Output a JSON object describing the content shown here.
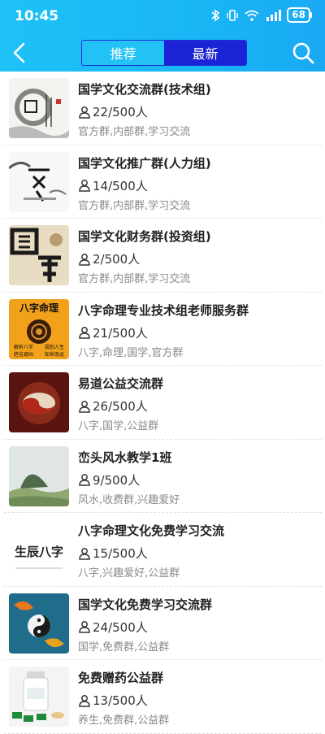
{
  "status": {
    "time": "10:45",
    "battery": "68"
  },
  "nav": {
    "tabs": [
      {
        "label": "推荐",
        "active": false
      },
      {
        "label": "最新",
        "active": true
      }
    ]
  },
  "colors": {
    "header": "#1ec2f6",
    "tab_active": "#1c22d6",
    "tags": "#8a8a8a"
  },
  "groups": [
    {
      "title": "国学文化交流群(技术组)",
      "count": "22/500人",
      "tags": "官方群,内部群,学习交流",
      "thumb": "ink-guoxue-icon"
    },
    {
      "title": "国学文化推广群(人力组)",
      "count": "14/500人",
      "tags": "官方群,内部群,学习交流",
      "thumb": "ink-calligraphy-icon"
    },
    {
      "title": "国学文化财务群(投资组)",
      "count": "2/500人",
      "tags": "官方群,内部群,学习交流",
      "thumb": "guoxue-calligraphy-icon"
    },
    {
      "title": "八字命理专业技术组老师服务群",
      "count": "21/500人",
      "tags": "八字,命理,国学,官方群",
      "thumb": "bazi-poster-icon",
      "thumb_text": [
        "八字命理",
        "解析八字",
        "规划人生",
        "趋吉避凶",
        "知命改运"
      ]
    },
    {
      "title": "易道公益交流群",
      "count": "26/500人",
      "tags": "八字,国学,公益群",
      "thumb": "yinyang-red-icon"
    },
    {
      "title": "峦头风水教学1班",
      "count": "9/500人",
      "tags": "风水,收费群,兴趣爱好",
      "thumb": "mountain-landscape-icon"
    },
    {
      "title": "八字命理文化免费学习交流",
      "count": "15/500人",
      "tags": "八字,兴趣爱好,公益群",
      "thumb": "shengchen-bazi-icon",
      "thumb_text": [
        "生辰八字"
      ]
    },
    {
      "title": "国学文化免费学习交流群",
      "count": "24/500人",
      "tags": "国学,免费群,公益群",
      "thumb": "koi-taiji-icon"
    },
    {
      "title": "免费赠药公益群",
      "count": "13/500人",
      "tags": "养生,免费群,公益群",
      "thumb": "medicine-bottle-icon"
    }
  ]
}
